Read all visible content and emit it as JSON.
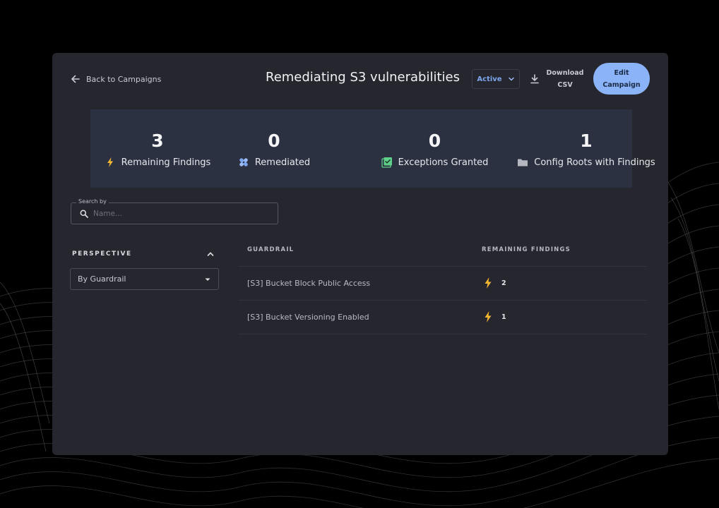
{
  "header": {
    "back_label": "Back to Campaigns",
    "title": "Remediating S3 vulnerabilities",
    "status_selected": "Active",
    "download_label": "Download CSV",
    "edit_label": "Edit Campaign"
  },
  "stats": [
    {
      "value": "3",
      "label": "Remaining Findings",
      "icon": "lightning-bolt-icon"
    },
    {
      "value": "0",
      "label": "Remediated",
      "icon": "bandage-icon"
    },
    {
      "value": "0",
      "label": "Exceptions Granted",
      "icon": "checklist-icon"
    },
    {
      "value": "1",
      "label": "Config Roots with Findings",
      "icon": "folder-icon"
    }
  ],
  "search": {
    "legend": "Search by",
    "placeholder": "Name..."
  },
  "perspective": {
    "title": "PERSPECTIVE",
    "selected": "By Guardrail"
  },
  "table": {
    "columns": [
      "GUARDRAIL",
      "REMAINING FINDINGS"
    ],
    "rows": [
      {
        "guardrail": "[S3] Bucket Block Public Access",
        "remaining": "2"
      },
      {
        "guardrail": "[S3] Bucket Versioning Enabled",
        "remaining": "1"
      }
    ]
  },
  "colors": {
    "page_bg": "#000000",
    "window_bg": "#25262e",
    "stats_bg": "#2b3140",
    "accent_blue": "#8bb4f8",
    "status_blue": "#7ea6ee",
    "bolt_yellow": "#f5b82e",
    "remediated_blue": "#9dbcf5",
    "exceptions_green": "#5fd08a"
  }
}
